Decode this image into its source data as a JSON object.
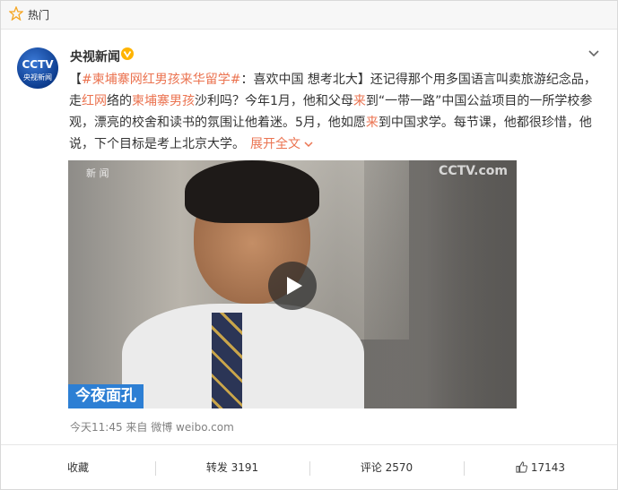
{
  "topbar": {
    "label": "热门"
  },
  "author": {
    "name": "央视新闻",
    "avatar_text": "CCTV",
    "avatar_sub": "央视新闻"
  },
  "post": {
    "bracket_open": "【",
    "hashtag": "#柬埔寨网红男孩来华留学#",
    "title_rest": "：喜欢中国 想考北大】",
    "seg1": "还记得那个用多国语言叫卖旅游纪念品，走",
    "hl1": "红网",
    "seg2": "络的",
    "hl2": "柬埔寨男孩",
    "seg3": "沙利吗？今年1月，他和父母",
    "hl3": "来",
    "seg4": "到“一带一路”中国公益项目的一所学校参观，漂亮的校舍和读书的氛围让他着迷。5月，他如愿",
    "hl4": "来",
    "seg5": "到中国求学。每节课，他都很珍惜，他说，下个目标是考上北京大学。",
    "more": "展开全文",
    "more_icon": "chevron-down"
  },
  "video": {
    "watermark_left": "新 闻",
    "watermark_right": "CCTV.com",
    "banner": "今夜面孔"
  },
  "meta": {
    "time": "今天11:45",
    "source": "来自 微博 weibo.com"
  },
  "actions": {
    "collect": "收藏",
    "repost": "转发 3191",
    "comment": "评论 2570",
    "like": "17143"
  },
  "colors": {
    "accent": "#eb7350",
    "banner": "#2d7fd4"
  }
}
